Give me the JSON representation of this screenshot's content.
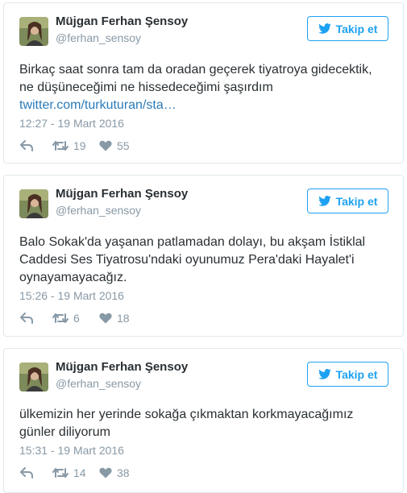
{
  "tweets": [
    {
      "name": "Müjgan Ferhan Şensoy",
      "handle": "@ferhan_sensoy",
      "follow_label": "Takip et",
      "text_line1": "Birkaç saat sonra tam da oradan geçerek tiyatroya gidecektik,",
      "text_line2": "ne düşüneceğimi ne hissedeceğimi şaşırdım",
      "link": "twitter.com/turkuturan/sta…",
      "timestamp": "12:27 - 19 Mart 2016",
      "retweets": "19",
      "likes": "55"
    },
    {
      "name": "Müjgan Ferhan Şensoy",
      "handle": "@ferhan_sensoy",
      "follow_label": "Takip et",
      "text_line1": "Balo Sokak'da yaşanan patlamadan dolayı, bu akşam İstiklal",
      "text_line2": "Caddesi Ses Tiyatrosu'ndaki oyunumuz Pera'daki Hayalet'i",
      "text_line3": "oynayamayacağız.",
      "timestamp": "15:26 - 19 Mart 2016",
      "retweets": "6",
      "likes": "18"
    },
    {
      "name": "Müjgan Ferhan Şensoy",
      "handle": "@ferhan_sensoy",
      "follow_label": "Takip et",
      "text_line1": "ülkemizin her yerinde sokağa çıkmaktan korkmayacağımız",
      "text_line2": "günler diliyorum",
      "timestamp": "15:31 - 19 Mart 2016",
      "retweets": "14",
      "likes": "38"
    }
  ],
  "colors": {
    "accent": "#1da1f2",
    "link": "#2b7bb9",
    "muted": "#8899a6",
    "border": "#e1e8ed"
  }
}
